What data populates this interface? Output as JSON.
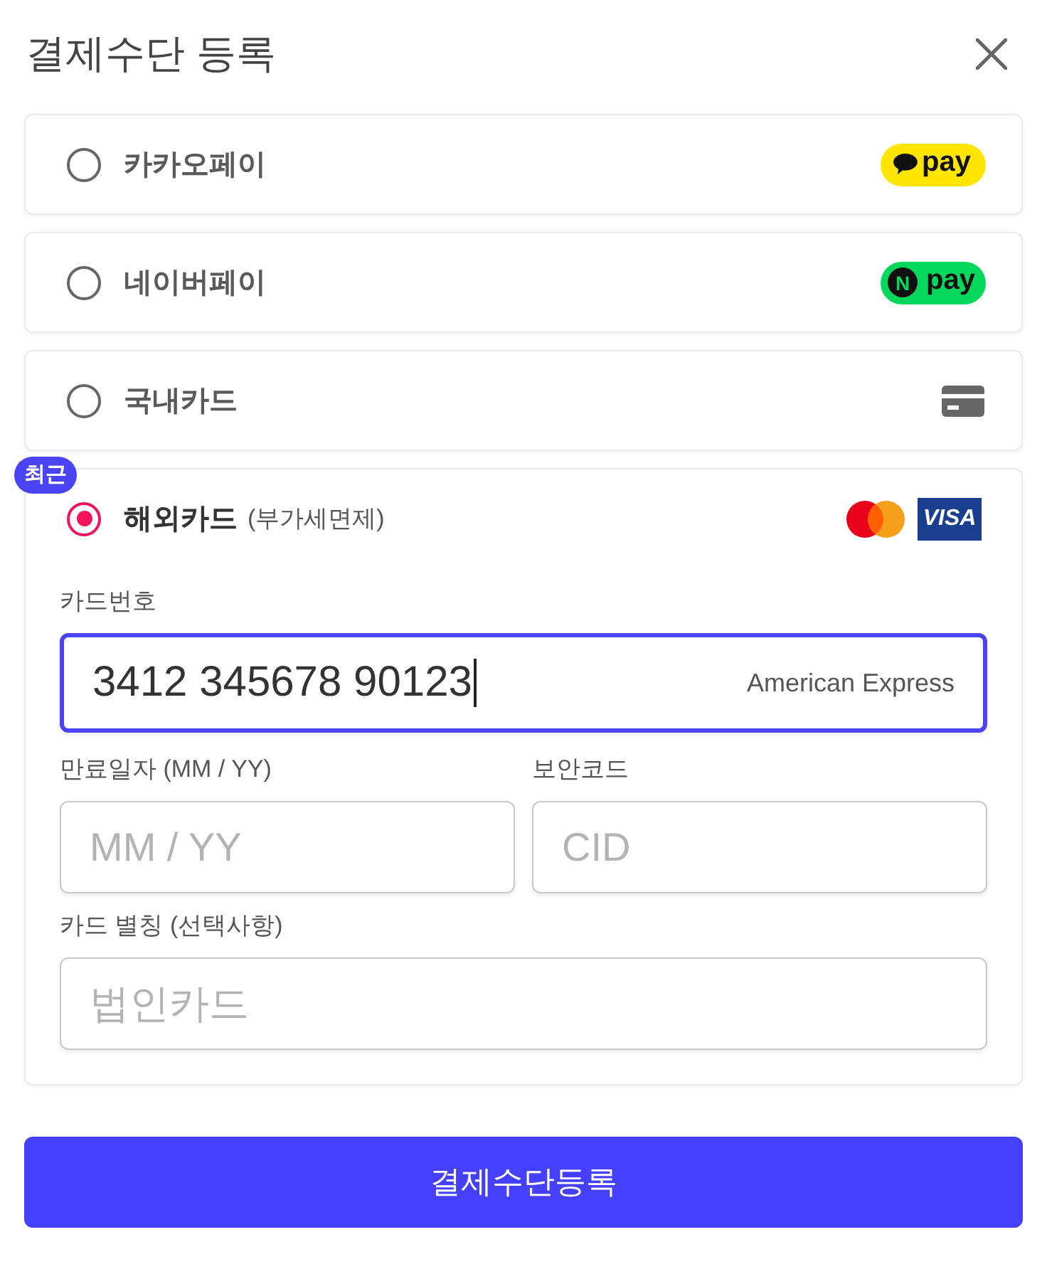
{
  "header": {
    "title": "결제수단 등록"
  },
  "methods": [
    {
      "kind": "kakaopay",
      "label": "카카오페이",
      "selected": false,
      "logo_text": "pay"
    },
    {
      "kind": "naverpay",
      "label": "네이버페이",
      "selected": false,
      "logo_letter": "N",
      "logo_text": "pay"
    },
    {
      "kind": "domestic_card",
      "label": "국내카드",
      "selected": false
    },
    {
      "kind": "foreign_card",
      "label": "해외카드",
      "note": "(부가세면제)",
      "badge": "최근",
      "selected": true,
      "logo_text": "VISA"
    }
  ],
  "card_form": {
    "card_number": {
      "label": "카드번호",
      "value": "3412 345678 90123",
      "brand": "American Express",
      "focused": true
    },
    "expiry": {
      "label": "만료일자 (MM / YY)",
      "placeholder": "MM / YY"
    },
    "security_code": {
      "label": "보안코드",
      "placeholder": "CID"
    },
    "nickname": {
      "label": "카드 별칭 (선택사항)",
      "placeholder": "법인카드"
    }
  },
  "submit_button": {
    "label": "결제수단등록"
  }
}
